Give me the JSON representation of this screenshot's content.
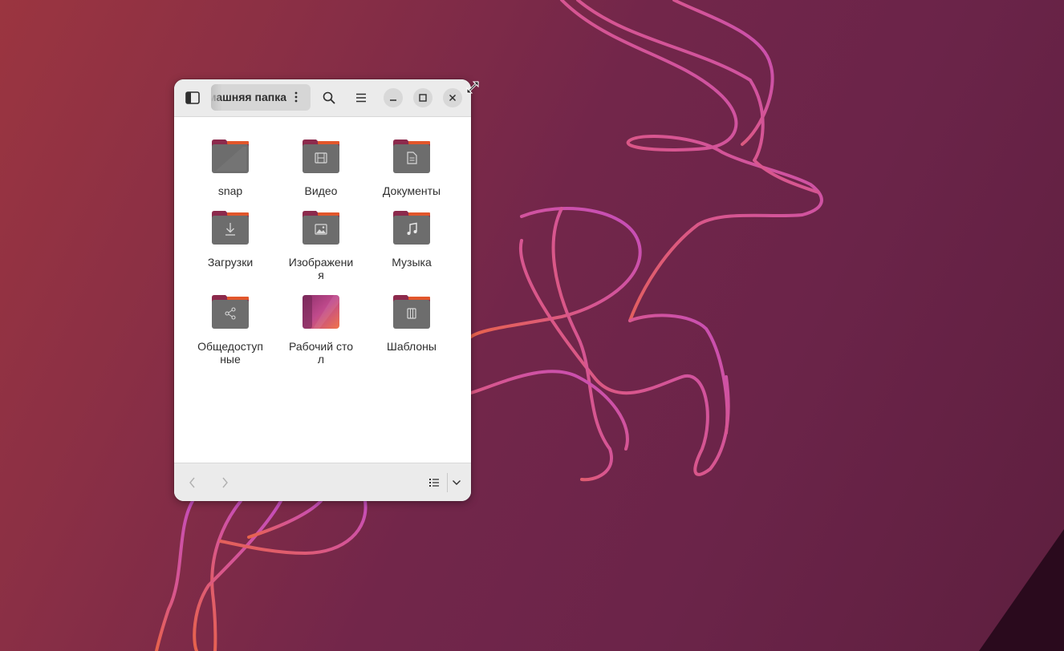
{
  "window": {
    "path_label": "Домашняя папка"
  },
  "icons": {
    "sidebar_toggle": "sidebar-icon",
    "path_menu": "vertical-dots-icon",
    "search": "search-icon",
    "menu": "hamburger-icon",
    "minimize": "minimize-icon",
    "maximize": "maximize-icon",
    "close": "close-icon",
    "back": "chevron-left-icon",
    "forward": "chevron-right-icon",
    "view_list": "list-view-icon",
    "view_options": "chevron-down-icon"
  },
  "folders": [
    {
      "label": "snap",
      "emblem": "none"
    },
    {
      "label": "Видео",
      "emblem": "film-icon"
    },
    {
      "label": "Документы",
      "emblem": "document-icon"
    },
    {
      "label": "Загрузки",
      "emblem": "download-icon"
    },
    {
      "label": "Изображения",
      "emblem": "image-icon"
    },
    {
      "label": "Музыка",
      "emblem": "music-icon"
    },
    {
      "label": "Общедоступные",
      "emblem": "share-icon"
    },
    {
      "label": "Рабочий стол",
      "emblem": "desktop-icon"
    },
    {
      "label": "Шаблоны",
      "emblem": "template-icon"
    }
  ],
  "colors": {
    "folder_tab": "#8c2a4c",
    "folder_tab_accent": "#e2562b",
    "folder_body": "#6d6d6d",
    "wallpaper_line": "#c04db3"
  }
}
